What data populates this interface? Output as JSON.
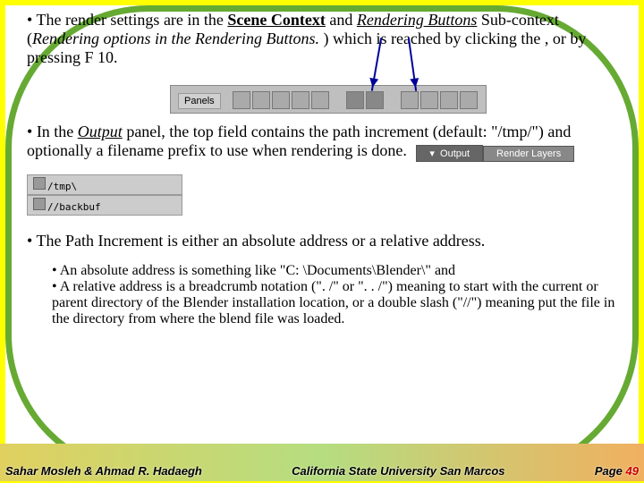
{
  "bullet1": {
    "t1": "The render settings are in the ",
    "scene": "Scene Context",
    "t2": " and ",
    "rb": "Rendering Buttons",
    "t3": " Sub-context (",
    "ro": "Rendering options in the  Rendering Buttons.",
    "t4": " ) which is reached by clicking the  , or by pressing F 10."
  },
  "panelsLabel": "Panels",
  "bullet2": {
    "t1": "In the ",
    "out": "Output",
    "t2": " panel, the top field contains the path increment (default: \"/tmp/\") and optionally a filename prefix to use when rendering is done."
  },
  "outputTab": "Output",
  "renderLayersTab": "Render Layers",
  "path1": "/tmp\\",
  "path2": "//backbuf",
  "bullet3": "The Path Increment is either an absolute address or a relative address.",
  "sub1": "An absolute address is something like \"C: \\Documents\\Blender\\\" and",
  "sub2": "A relative address is a breadcrumb notation (\". /\" or \". . /\") meaning to start with the current or parent directory of the Blender installation location, or a double slash (\"//\") meaning put the file in the directory from where the blend file was loaded.",
  "authors": "Sahar Mosleh & Ahmad R. Hadaegh",
  "university": "California State University San Marcos",
  "pageLabel": "Page ",
  "pageNum": "49"
}
